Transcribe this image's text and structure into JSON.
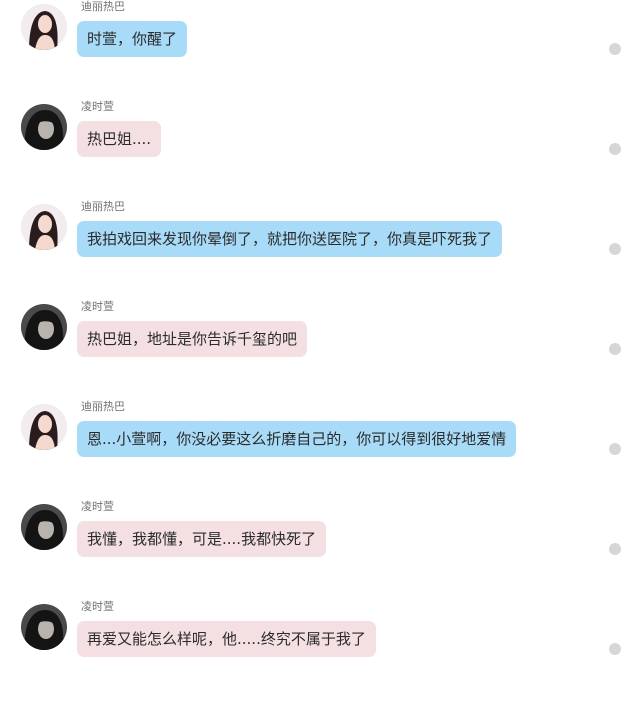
{
  "messages": [
    {
      "sender": "迪丽热巴",
      "text": "时萱，你醒了",
      "bubble_color": "#a7dbf8",
      "avatar": "female-avatar"
    },
    {
      "sender": "凌时萱",
      "text": "热巴姐....",
      "bubble_color": "#f4e0e2",
      "avatar": "dark-hair-avatar"
    },
    {
      "sender": "迪丽热巴",
      "text": "我拍戏回来发现你晕倒了，就把你送医院了，你真是吓死我了",
      "bubble_color": "#a7dbf8",
      "avatar": "female-avatar"
    },
    {
      "sender": "凌时萱",
      "text": "热巴姐，地址是你告诉千玺的吧",
      "bubble_color": "#f4e0e2",
      "avatar": "dark-hair-avatar"
    },
    {
      "sender": "迪丽热巴",
      "text": "恩...小萱啊，你没必要这么折磨自己的，你可以得到很好地爱情",
      "bubble_color": "#a7dbf8",
      "avatar": "female-avatar"
    },
    {
      "sender": "凌时萱",
      "text": "我懂，我都懂，可是....我都快死了",
      "bubble_color": "#f4e0e2",
      "avatar": "dark-hair-avatar"
    },
    {
      "sender": "凌时萱",
      "text": "再爱又能怎么样呢，他.....终究不属于我了",
      "bubble_color": "#f4e0e2",
      "avatar": "dark-hair-avatar"
    }
  ]
}
